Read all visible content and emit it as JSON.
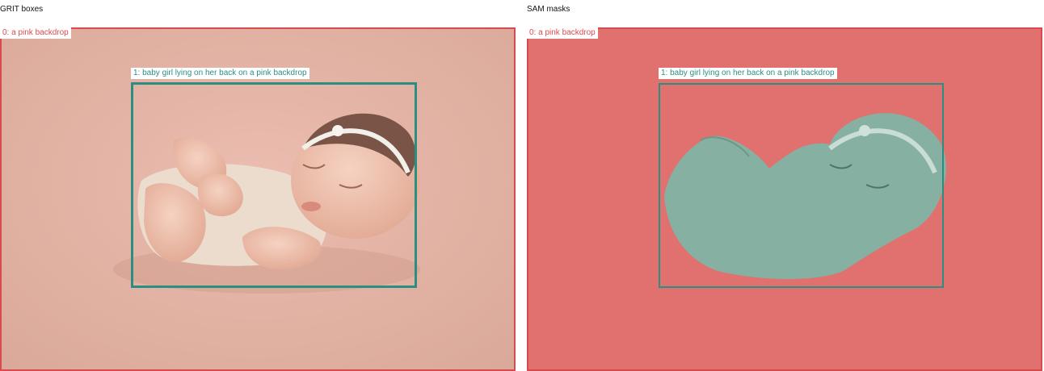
{
  "panels": [
    {
      "title": "GRIT boxes",
      "boxes": [
        {
          "label": "0: a pink backdrop",
          "color": "#d94b4b"
        },
        {
          "label": "1: baby girl lying on her back on a pink backdrop",
          "color": "#2a8f80"
        }
      ]
    },
    {
      "title": "SAM masks",
      "boxes": [
        {
          "label": "0: a pink backdrop",
          "color": "#d94b4b"
        },
        {
          "label": "1: baby girl lying on her back on a pink backdrop",
          "color": "#2a8f80"
        }
      ]
    }
  ],
  "colors": {
    "backdrop_photo": "#e3b1a3",
    "backdrop_mask": "#e0716e",
    "baby_mask": "#86b0a2",
    "box_red": "#d94b4b",
    "box_teal": "#2a8f80"
  }
}
